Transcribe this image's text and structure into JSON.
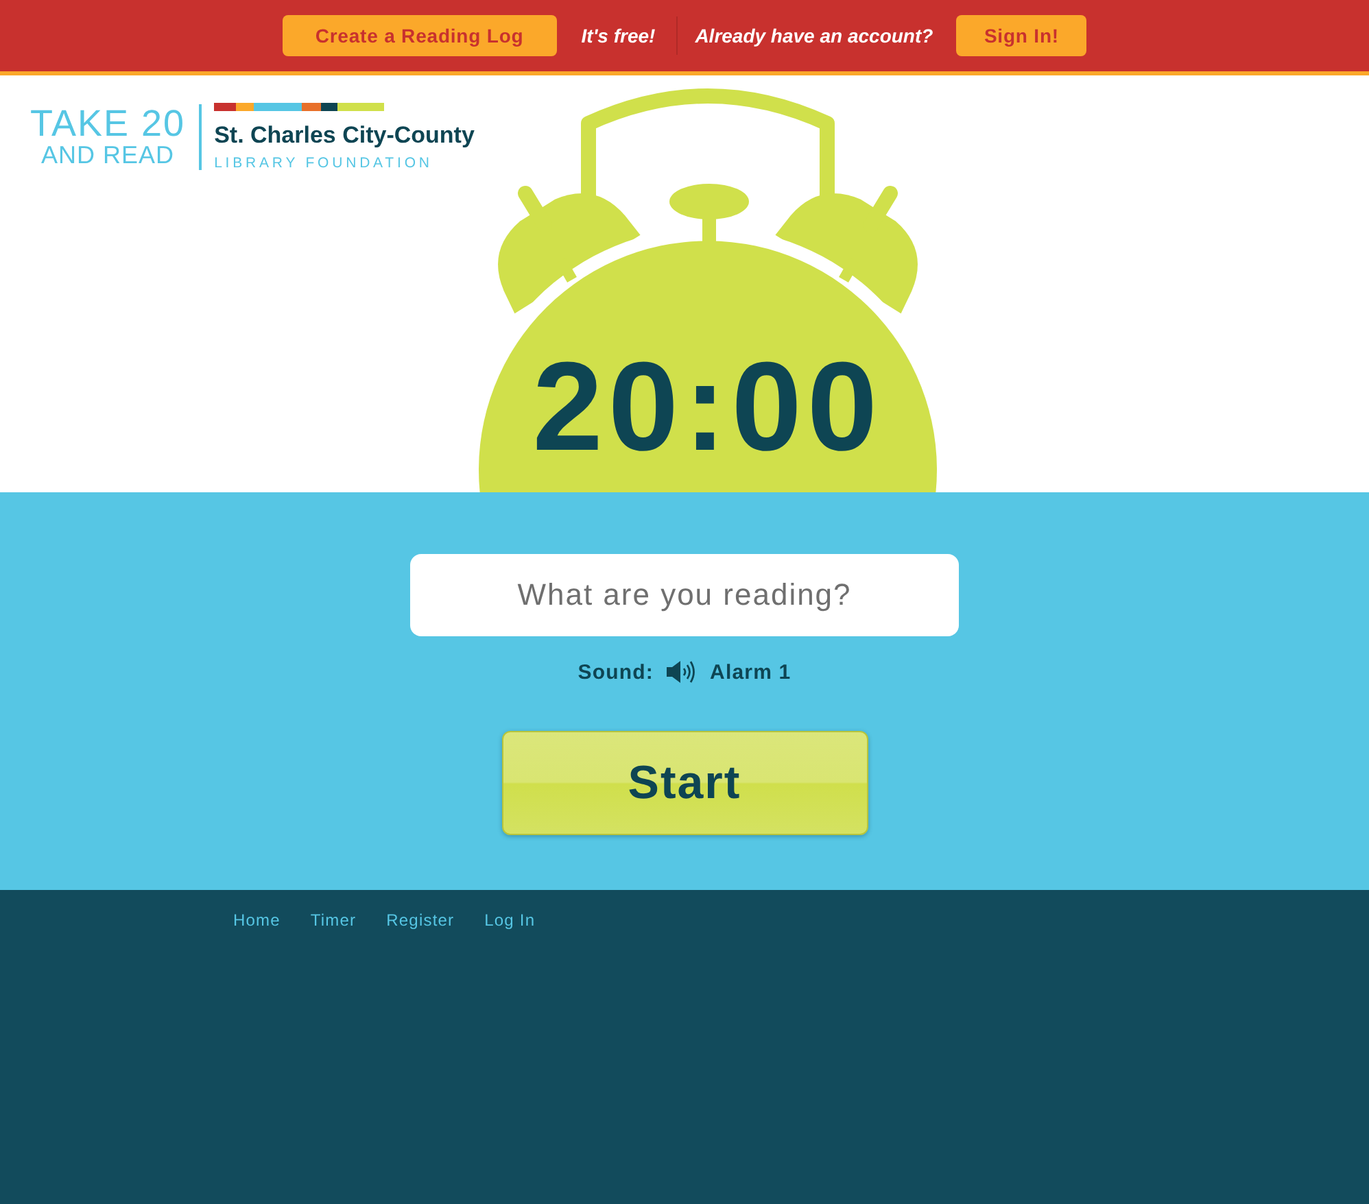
{
  "top_bar": {
    "signup_button": "Create a Reading Log",
    "free_note": "It's free!",
    "account_prompt": "Already have an account?",
    "signin_button": "Sign In!"
  },
  "logo": {
    "title_line_1": "TAKE 20",
    "title_line_2": "AND READ",
    "org_name": "St. Charles City-County",
    "org_subtitle": "LIBRARY FOUNDATION"
  },
  "timer": {
    "display": "20:00"
  },
  "reading_field": {
    "placeholder": "What are you reading?"
  },
  "sound": {
    "label": "Sound:",
    "value": "Alarm 1"
  },
  "start_button": "Start",
  "footer": {
    "links": [
      "Home",
      "Timer",
      "Register",
      "Log In"
    ]
  }
}
